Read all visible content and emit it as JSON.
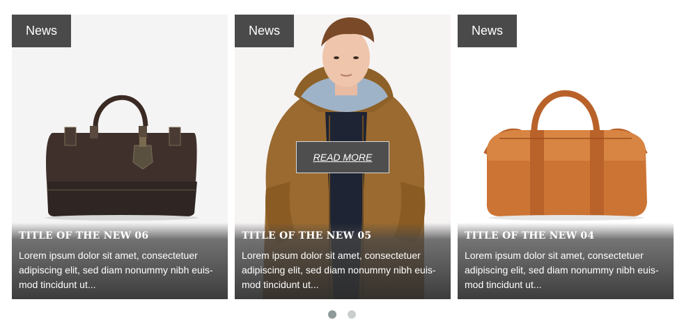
{
  "cards": [
    {
      "badge": "News",
      "title": "TITLE OF THE NEW 06",
      "text": "Lorem ipsum dolor sit amet, consectetuer adipiscing elit, sed diam nonummy nibh euis-mod tincidunt ut..."
    },
    {
      "badge": "News",
      "title": "TITLE OF THE NEW 05",
      "text": "Lorem ipsum dolor sit amet, consectetuer adipiscing elit, sed diam nonummy nibh euis-mod tincidunt ut...",
      "read_more": "READ MORE"
    },
    {
      "badge": "News",
      "title": "TITLE OF THE NEW 04",
      "text": "Lorem ipsum dolor sit amet, consectetuer adipiscing elit, sed diam nonummy nibh euis-mod tincidunt ut..."
    }
  ],
  "pagination": {
    "pages": 2,
    "active_index": 0
  },
  "colors": {
    "badge_bg": "#4a4a4a",
    "dot_active": "#8f9999",
    "dot_inactive": "#c9cfcf"
  },
  "icons": {
    "card1": "dark-leather-bag-image",
    "card2": "man-in-jacket-image",
    "card3": "tan-leather-duffel-image"
  }
}
